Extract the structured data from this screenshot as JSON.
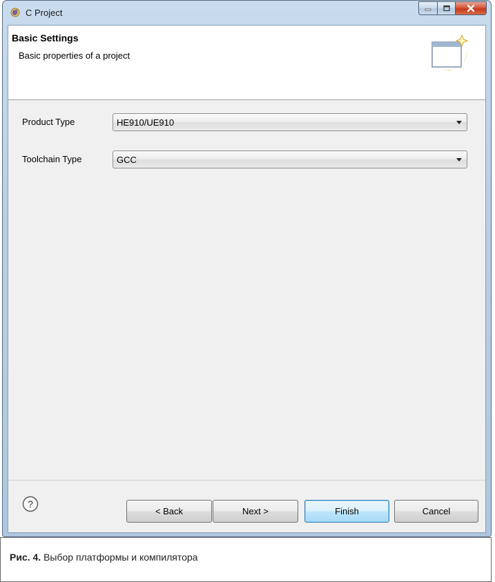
{
  "window": {
    "title": "C Project",
    "icons": {
      "app": "eclipse-c-project-icon",
      "minimize": "minimize-icon",
      "maximize": "maximize-icon",
      "close": "close-icon"
    }
  },
  "header": {
    "title": "Basic Settings",
    "subtitle": "Basic properties of a project",
    "icon": "new-project-wizard-icon"
  },
  "form": {
    "product_type": {
      "label": "Product Type",
      "value": "HE910/UE910"
    },
    "toolchain_type": {
      "label": "Toolchain Type",
      "value": "GCC"
    }
  },
  "footer": {
    "help_icon": "help-icon",
    "back_label": "< Back",
    "next_label": "Next >",
    "finish_label": "Finish",
    "cancel_label": "Cancel"
  },
  "caption": {
    "figure_label": "Рис. 4.",
    "text": " Выбор платформы и компилятора"
  },
  "colors": {
    "frame": "#b9cfe6",
    "close_button": "#c43b1c",
    "default_button_border": "#3c7fb1",
    "client_background": "#f0f0f0"
  }
}
